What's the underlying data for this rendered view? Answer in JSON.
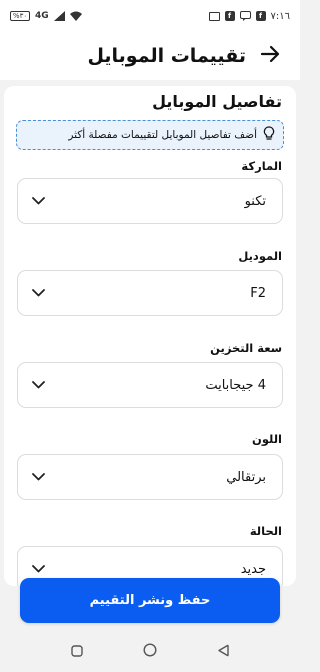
{
  "status_bar": {
    "time": "٧:١٦",
    "battery": "%٣٠",
    "network": "4G",
    "left_icons": [
      "battery-icon",
      "network-4g-icon",
      "signal-icon",
      "wifi-icon"
    ],
    "right_icons": [
      "image-icon",
      "facebook-icon",
      "message-icon",
      "facebook-icon"
    ]
  },
  "header": {
    "title": "تقييمات الموبايل",
    "back_icon": "arrow-right-icon"
  },
  "section": {
    "title": "تفاصيل الموبايل",
    "hint": "أضف تفاصيل الموبايل لتقييمات مفصلة أكثر",
    "hint_icon": "lightbulb-icon"
  },
  "fields": [
    {
      "label": "الماركة",
      "value": "تكنو"
    },
    {
      "label": "الموديل",
      "value": "F2"
    },
    {
      "label": "سعة التخزين",
      "value": "4 جيجابايت"
    },
    {
      "label": "اللون",
      "value": "برتقالي"
    },
    {
      "label": "الحالة",
      "value": "جديد"
    }
  ],
  "save_button": "حفظ ونشر التقييم",
  "colors": {
    "accent": "#0b5df2",
    "hint_bg": "#eaf3fc",
    "hint_border": "#4a8fd6"
  }
}
